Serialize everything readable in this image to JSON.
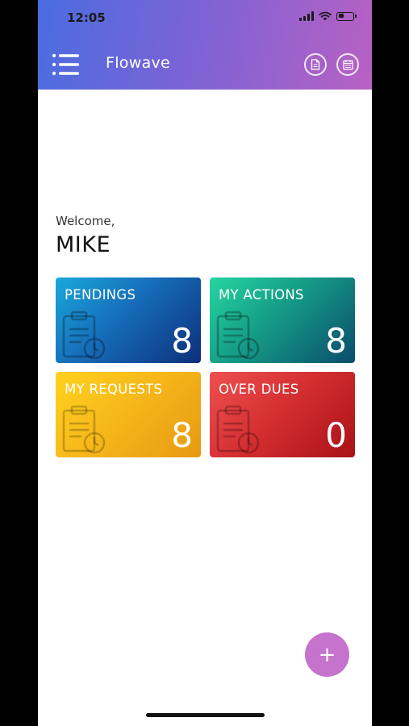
{
  "status_bar": {
    "time": "12:05"
  },
  "header": {
    "title": "Flowave",
    "icons": [
      "menu-icon",
      "document-icon",
      "calendar-icon"
    ]
  },
  "greeting": {
    "welcome": "Welcome,",
    "name": "MIKE"
  },
  "cards": [
    {
      "label": "PENDINGS",
      "count": "8",
      "color": "#166cb8"
    },
    {
      "label": "MY ACTIONS",
      "count": "8",
      "color": "#159a86"
    },
    {
      "label": "MY REQUESTS",
      "count": "8",
      "color": "#f5b61a"
    },
    {
      "label": "OVER DUES",
      "count": "0",
      "color": "#d22d2f"
    }
  ],
  "fab": {
    "label": "+",
    "color": "#c573cc"
  }
}
